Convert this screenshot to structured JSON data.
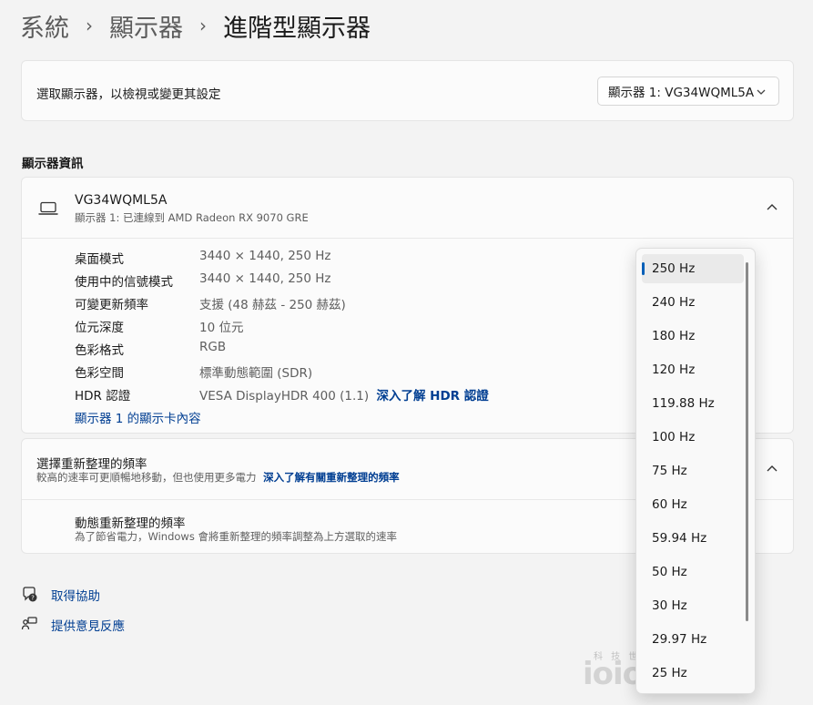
{
  "breadcrumb": {
    "items": [
      "系統",
      "顯示器"
    ],
    "current": "進階型顯示器",
    "sep": "›"
  },
  "selector": {
    "label": "選取顯示器，以檢視或變更其設定",
    "value": "顯示器 1: VG34WQML5A",
    "chevron": "⌄"
  },
  "display_info": {
    "section_title": "顯示器資訊",
    "monitor_name": "VG34WQML5A",
    "monitor_sub": "顯示器 1: 已連線到 AMD Radeon RX 9070 GRE",
    "rows": [
      {
        "label": "桌面模式",
        "value": "3440 × 1440, 250 Hz"
      },
      {
        "label": "使用中的信號模式",
        "value": "3440 × 1440, 250 Hz"
      },
      {
        "label": "可變更新頻率",
        "value": "支援 (48 赫茲 - 250 赫茲)"
      },
      {
        "label": "位元深度",
        "value": "10 位元"
      },
      {
        "label": "色彩格式",
        "value": "RGB"
      },
      {
        "label": "色彩空間",
        "value": "標準動態範圍 (SDR)"
      },
      {
        "label": "HDR 認證",
        "value": "VESA DisplayHDR 400 (1.1)",
        "link": "深入了解 HDR 認證"
      }
    ],
    "adapter_link": "顯示器 1 的顯示卡內容"
  },
  "refresh": {
    "title": "選擇重新整理的頻率",
    "sub": "較高的速率可更順暢地移動，但也使用更多電力",
    "link": "深入了解有關重新整理的頻率",
    "dynamic_title": "動態重新整理的頻率",
    "dynamic_sub": "為了節省電力，Windows 會將重新整理的頻率調整為上方選取的速率",
    "options": [
      "250 Hz",
      "240 Hz",
      "180 Hz",
      "120 Hz",
      "119.88 Hz",
      "100 Hz",
      "75 Hz",
      "60 Hz",
      "59.94 Hz",
      "50 Hz",
      "30 Hz",
      "29.97 Hz",
      "25 Hz"
    ],
    "selected": "250 Hz"
  },
  "footer": {
    "help": "取得協助",
    "feedback": "提供意見反應"
  },
  "watermark": {
    "small": "科 技 世 代",
    "brand": "ioio TIMES"
  },
  "colors": {
    "accent": "#005fb8",
    "link": "#003e92"
  }
}
